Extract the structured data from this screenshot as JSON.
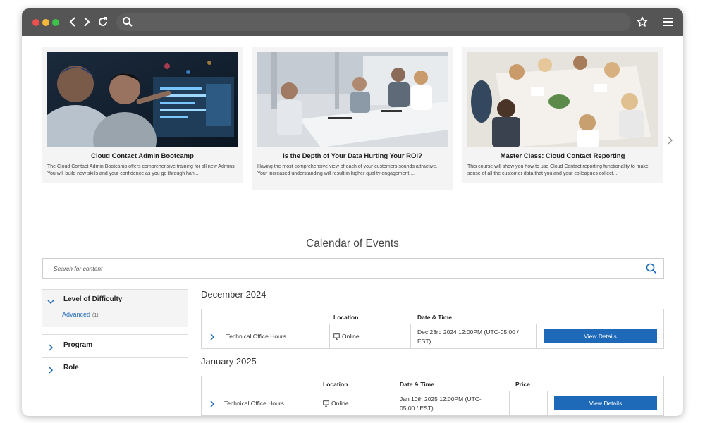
{
  "cards": [
    {
      "title": "Cloud Contact Admin Bootcamp",
      "desc": "The Cloud Contact Admin Bootcamp offers comprehensive training for all new Admins. You will build new skills and your confidence as you go through han..."
    },
    {
      "title": "Is the Depth of Your Data Hurting Your ROI?",
      "desc": "Having the most comprehensive view of each of your customers sounds attractive. Your increased understanding will result in higher quality engagement ..."
    },
    {
      "title": "Master Class: Cloud Contact Reporting",
      "desc": "This course will show you how to use Cloud Contact reporting functionality to make sense of all the customer data that you and your colleagues collect..."
    }
  ],
  "calendar": {
    "title": "Calendar of Events",
    "search_placeholder": "Search for content"
  },
  "filters": {
    "difficulty": {
      "label": "Level of Difficulty",
      "option": "Advanced",
      "count": "(1)"
    },
    "program": "Program",
    "role": "Role"
  },
  "months": [
    {
      "name": "December 2024",
      "headers": {
        "location": "Location",
        "datetime": "Date & Time"
      },
      "event": {
        "name": "Technical Office Hours",
        "location": "Online",
        "datetime_line1": "Dec 23rd 2024 12:00PM (UTC-05:00 /",
        "datetime_line2": "EST)",
        "button": "View Details"
      }
    },
    {
      "name": "January 2025",
      "headers": {
        "location": "Location",
        "datetime": "Date & Time",
        "price": "Price"
      },
      "event": {
        "name": "Technical Office Hours",
        "location": "Online",
        "datetime_line1": "Jan 10th 2025 12:00PM (UTC-",
        "datetime_line2": "05:00 / EST)",
        "button": "View Details"
      }
    }
  ],
  "colors": {
    "accent": "#1e6ab8",
    "chrome": "#555555"
  }
}
